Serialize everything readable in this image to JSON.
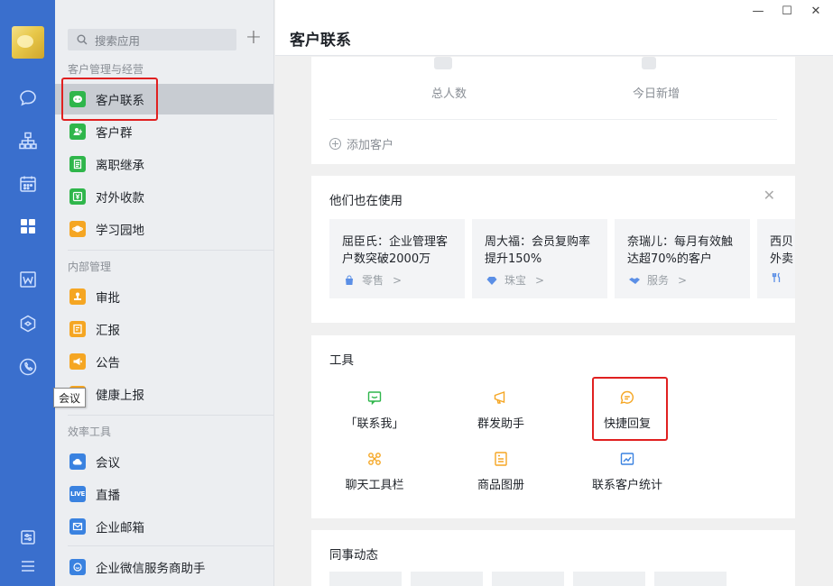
{
  "rail": {
    "icons": [
      "avatar",
      "chat-icon",
      "org-chart-icon",
      "calendar-icon",
      "apps-grid-icon",
      "doc-w-icon",
      "cube-icon",
      "phone-icon",
      "settings-icon",
      "menu-icon"
    ]
  },
  "sidebar": {
    "search_placeholder": "搜索应用",
    "sections": [
      {
        "title": "客户管理与经营",
        "items": [
          {
            "label": "客户联系",
            "color": "#2fb64b",
            "icon": "chat-bubble-icon",
            "active": true
          },
          {
            "label": "客户群",
            "color": "#2fb64b",
            "icon": "group-icon"
          },
          {
            "label": "离职继承",
            "color": "#2fb64b",
            "icon": "doc-icon"
          },
          {
            "label": "对外收款",
            "color": "#2fb64b",
            "icon": "payment-icon"
          },
          {
            "label": "学习园地",
            "color": "#f5a623",
            "icon": "planet-icon"
          }
        ]
      },
      {
        "title": "内部管理",
        "items": [
          {
            "label": "审批",
            "color": "#f5a623",
            "icon": "stamp-icon"
          },
          {
            "label": "汇报",
            "color": "#f5a623",
            "icon": "report-icon"
          },
          {
            "label": "公告",
            "color": "#f5a623",
            "icon": "megaphone-icon"
          },
          {
            "label": "健康上报",
            "color": "#f5a623",
            "icon": "health-icon"
          }
        ]
      },
      {
        "title": "效率工具",
        "items": [
          {
            "label": "会议",
            "color": "#3a82e0",
            "icon": "cloud-icon"
          },
          {
            "label": "直播",
            "color": "#3a82e0",
            "icon": "live-icon",
            "badge": "LIVE"
          },
          {
            "label": "企业邮箱",
            "color": "#3a82e0",
            "icon": "mail-icon"
          },
          {
            "label": "企业微信服务商助手",
            "color": "#3a82e0",
            "icon": "helper-icon"
          }
        ]
      }
    ],
    "tooltip": "会议"
  },
  "main": {
    "title": "客户联系",
    "window_controls": [
      "—",
      "☐",
      "✕"
    ],
    "stats": {
      "total_label": "总人数",
      "today_label": "今日新增"
    },
    "add_customer": "添加客户",
    "cases": {
      "title": "他们也在使用",
      "items": [
        {
          "text": "屈臣氏：企业管理客户数突破2000万",
          "tag": "零售",
          "tag_icon": "bag-icon"
        },
        {
          "text": "周大福：会员复购率提升150%",
          "tag": "珠宝",
          "tag_icon": "diamond-icon"
        },
        {
          "text": "奈瑞儿：每月有效触达超70%的客户",
          "tag": "服务",
          "tag_icon": "handshake-icon"
        },
        {
          "text": "西贝外卖",
          "tag": "",
          "tag_icon": "fork-icon"
        }
      ]
    },
    "tools": {
      "title": "工具",
      "items": [
        {
          "label": "「联系我」",
          "icon": "contact-me-icon",
          "color": "#2fb64b"
        },
        {
          "label": "群发助手",
          "icon": "broadcast-icon",
          "color": "#f5a623"
        },
        {
          "label": "快捷回复",
          "icon": "quick-reply-icon",
          "color": "#f5a623"
        },
        {
          "label": "聊天工具栏",
          "icon": "toolbar-icon",
          "color": "#f5a623"
        },
        {
          "label": "商品图册",
          "icon": "catalog-icon",
          "color": "#f5a623"
        },
        {
          "label": "联系客户统计",
          "icon": "stats-icon",
          "color": "#3a82e0"
        }
      ]
    },
    "activity": {
      "title": "同事动态"
    }
  }
}
